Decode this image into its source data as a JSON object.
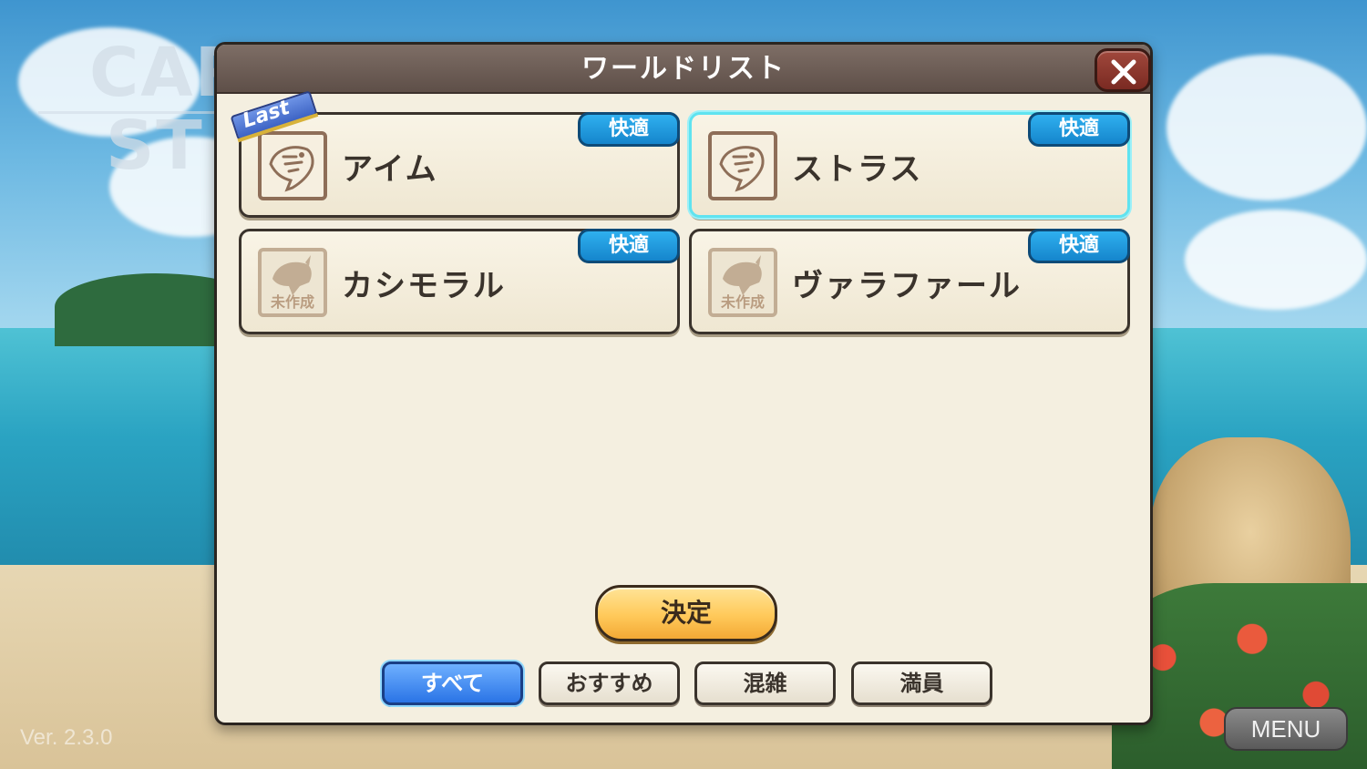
{
  "background": {
    "logo_line1": "CAR",
    "logo_line2": "ST",
    "version": "Ver. 2.3.0",
    "menu_label": "MENU"
  },
  "dialog": {
    "title": "ワールドリスト",
    "close_icon": "close-x-icon"
  },
  "worlds": [
    {
      "name": "アイム",
      "status": "快適",
      "last": "Last",
      "created": true,
      "selected": false
    },
    {
      "name": "ストラス",
      "status": "快適",
      "created": true,
      "selected": true
    },
    {
      "name": "カシモラル",
      "status": "快適",
      "created": false,
      "uncreated_label": "未作成",
      "selected": false
    },
    {
      "name": "ヴァラファール",
      "status": "快適",
      "created": false,
      "uncreated_label": "未作成",
      "selected": false
    }
  ],
  "confirm_label": "決定",
  "filters": [
    {
      "label": "すべて",
      "active": true
    },
    {
      "label": "おすすめ",
      "active": false
    },
    {
      "label": "混雑",
      "active": false
    },
    {
      "label": "満員",
      "active": false
    }
  ],
  "colors": {
    "status_badge": "#1f96dc",
    "selected_outline": "#5fe3f0",
    "confirm_button": "#ffc95a",
    "active_filter": "#2a74e6"
  }
}
